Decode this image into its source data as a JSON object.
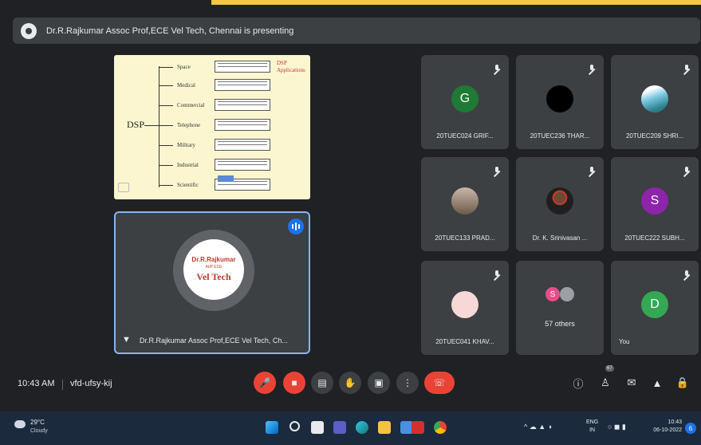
{
  "presenting_bar": {
    "text": "Dr.R.Rajkumar Assoc Prof,ECE Vel Tech, Chennai is presenting"
  },
  "slide": {
    "root": "DSP",
    "branches": [
      "Space",
      "Medical",
      "Commercial",
      "Telephone",
      "Military",
      "Industrial",
      "Scientific"
    ],
    "heading": "DSP Applications"
  },
  "presenter_tile": {
    "name": "Dr.R.Rajkumar Assoc Prof,ECE Vel Tech, Ch...",
    "logo_line1": "Dr.R.Rajkumar",
    "logo_line2": "AI/P ECE",
    "logo_line3": "Vel Tech"
  },
  "participants": [
    {
      "name": "20TUEC024 GRIF...",
      "initial": "G",
      "color": "#1e7a34"
    },
    {
      "name": "20TUEC236 THAR...",
      "initial": "",
      "color": "#000000"
    },
    {
      "name": "20TUEC209 SHRI...",
      "initial": "",
      "color": "#7ec8e3"
    },
    {
      "name": "20TUEC133 PRAD...",
      "initial": "",
      "color": "#a88c7a"
    },
    {
      "name": "Dr. K. Srinivasan ...",
      "initial": "",
      "color": "#ffffff"
    },
    {
      "name": "20TUEC222 SUBH...",
      "initial": "S",
      "color": "#8e24aa"
    },
    {
      "name": "20TUEC041 KHAV...",
      "initial": "",
      "color": "#f8d7d7"
    },
    {
      "name": "57 others",
      "initial": "S",
      "color": "#e84d8a"
    },
    {
      "name": "You",
      "initial": "D",
      "color": "#34a853"
    }
  ],
  "meeting": {
    "time": "10:43 AM",
    "code": "vfd-ufsy-kij"
  },
  "controls": {
    "people_count": "67",
    "icons": [
      "mic-off-icon",
      "camera-off-icon",
      "captions-icon",
      "raise-hand-icon",
      "present-icon",
      "more-options-icon",
      "end-call-icon"
    ],
    "right_icons": [
      "info-icon",
      "people-icon",
      "chat-icon",
      "activities-icon",
      "host-controls-icon"
    ]
  },
  "taskbar": {
    "temperature": "29°C",
    "condition": "Cloudy",
    "lang_line1": "ENG",
    "lang_line2": "IN",
    "clock": "10:43",
    "date": "06-10-2022",
    "notifications": "6"
  }
}
